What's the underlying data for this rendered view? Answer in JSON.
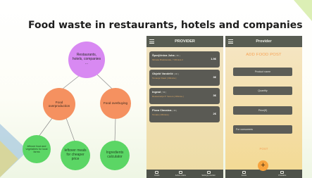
{
  "slide": {
    "title": "Food waste in restaurants, hotels and companies",
    "colors": {
      "purple": "#d889f2",
      "orange": "#f59160",
      "green": "#5bd665",
      "accent": "#f7a33d"
    }
  },
  "mindmap": {
    "root": "Restaurants, hotels, companies ...",
    "overproduction": "Food overproduction",
    "overbuying": "Food overbuying",
    "leaf_left": "leftover food and vegetables for local farms",
    "leaf_mid": "leftover meals for cheaper price",
    "leaf_right": "Ingredients calculator"
  },
  "provider_screen": {
    "title": "PROVIDER",
    "menu_icon": "hamburger-icon",
    "cards": [
      {
        "name": "Šporjižnica Juha",
        "category": "[ 5€ ]",
        "subtitle": "Mlinska Bratislavska, 7 Ribnica 2",
        "amount": "1.5€"
      },
      {
        "name": "Objekt Vandelić",
        "category": "[ 4€ ]",
        "subtitle": "Tomanja Vlasic [ Ribnica ]",
        "amount": "3€"
      },
      {
        "name": "Ingrad",
        "category": "[ 5€ ]",
        "subtitle": "Restavracija 3° Vecero [ Ribnica ]",
        "amount": "3€"
      },
      {
        "name": "Pizza Classica",
        "category": "[ 3€ ]",
        "subtitle": "Tomato [ Ribnica ]",
        "amount": "2€"
      }
    ],
    "nav": [
      {
        "icon": "box-icon",
        "label": "Foods"
      },
      {
        "icon": "list-icon",
        "label": "Active orders"
      },
      {
        "icon": "settings-icon",
        "label": "Settings provider"
      }
    ]
  },
  "add_post_screen": {
    "title": "Provider",
    "menu_icon": "hamburger-icon",
    "heading": "ADD FOOD POST",
    "fields": [
      "Product name",
      "Quantity",
      "Price(€)",
      "For consumers"
    ],
    "post_label": "POST",
    "fab_label": "+",
    "nav": [
      {
        "icon": "home-icon",
        "label": "Foods"
      },
      {
        "icon": "user-icon",
        "label": "Providers"
      }
    ]
  }
}
